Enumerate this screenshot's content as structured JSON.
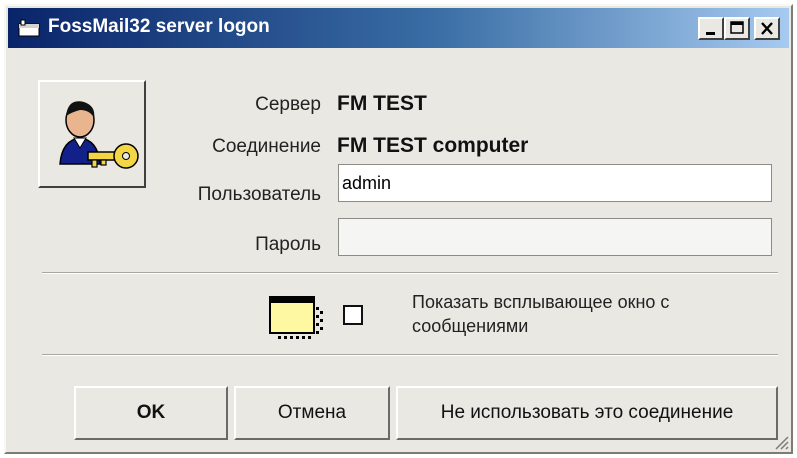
{
  "window": {
    "title": "FossMail32 server logon",
    "icon": "app-icon"
  },
  "titlebar_buttons": {
    "minimize_icon": "minimize-icon",
    "maximize_icon": "maximize-icon",
    "close_icon": "close-icon"
  },
  "server": {
    "label": "Сервер",
    "value": "FM  TEST"
  },
  "connection": {
    "label": "Соединение",
    "value": "FM  TEST computer"
  },
  "user": {
    "label": "Пользователь",
    "value": "admin"
  },
  "password": {
    "label": "Пароль",
    "value": ""
  },
  "popup": {
    "icon": "popup-window-icon",
    "checked": false,
    "label": "Показать всплывающее окно с сообщениями"
  },
  "buttons": {
    "ok": "OK",
    "cancel": "Отмена",
    "skip": "Не использовать это соединение"
  },
  "colors": {
    "titlebar_start": "#0a246a",
    "titlebar_end": "#a6caf0",
    "face": "#e9e8e3"
  }
}
